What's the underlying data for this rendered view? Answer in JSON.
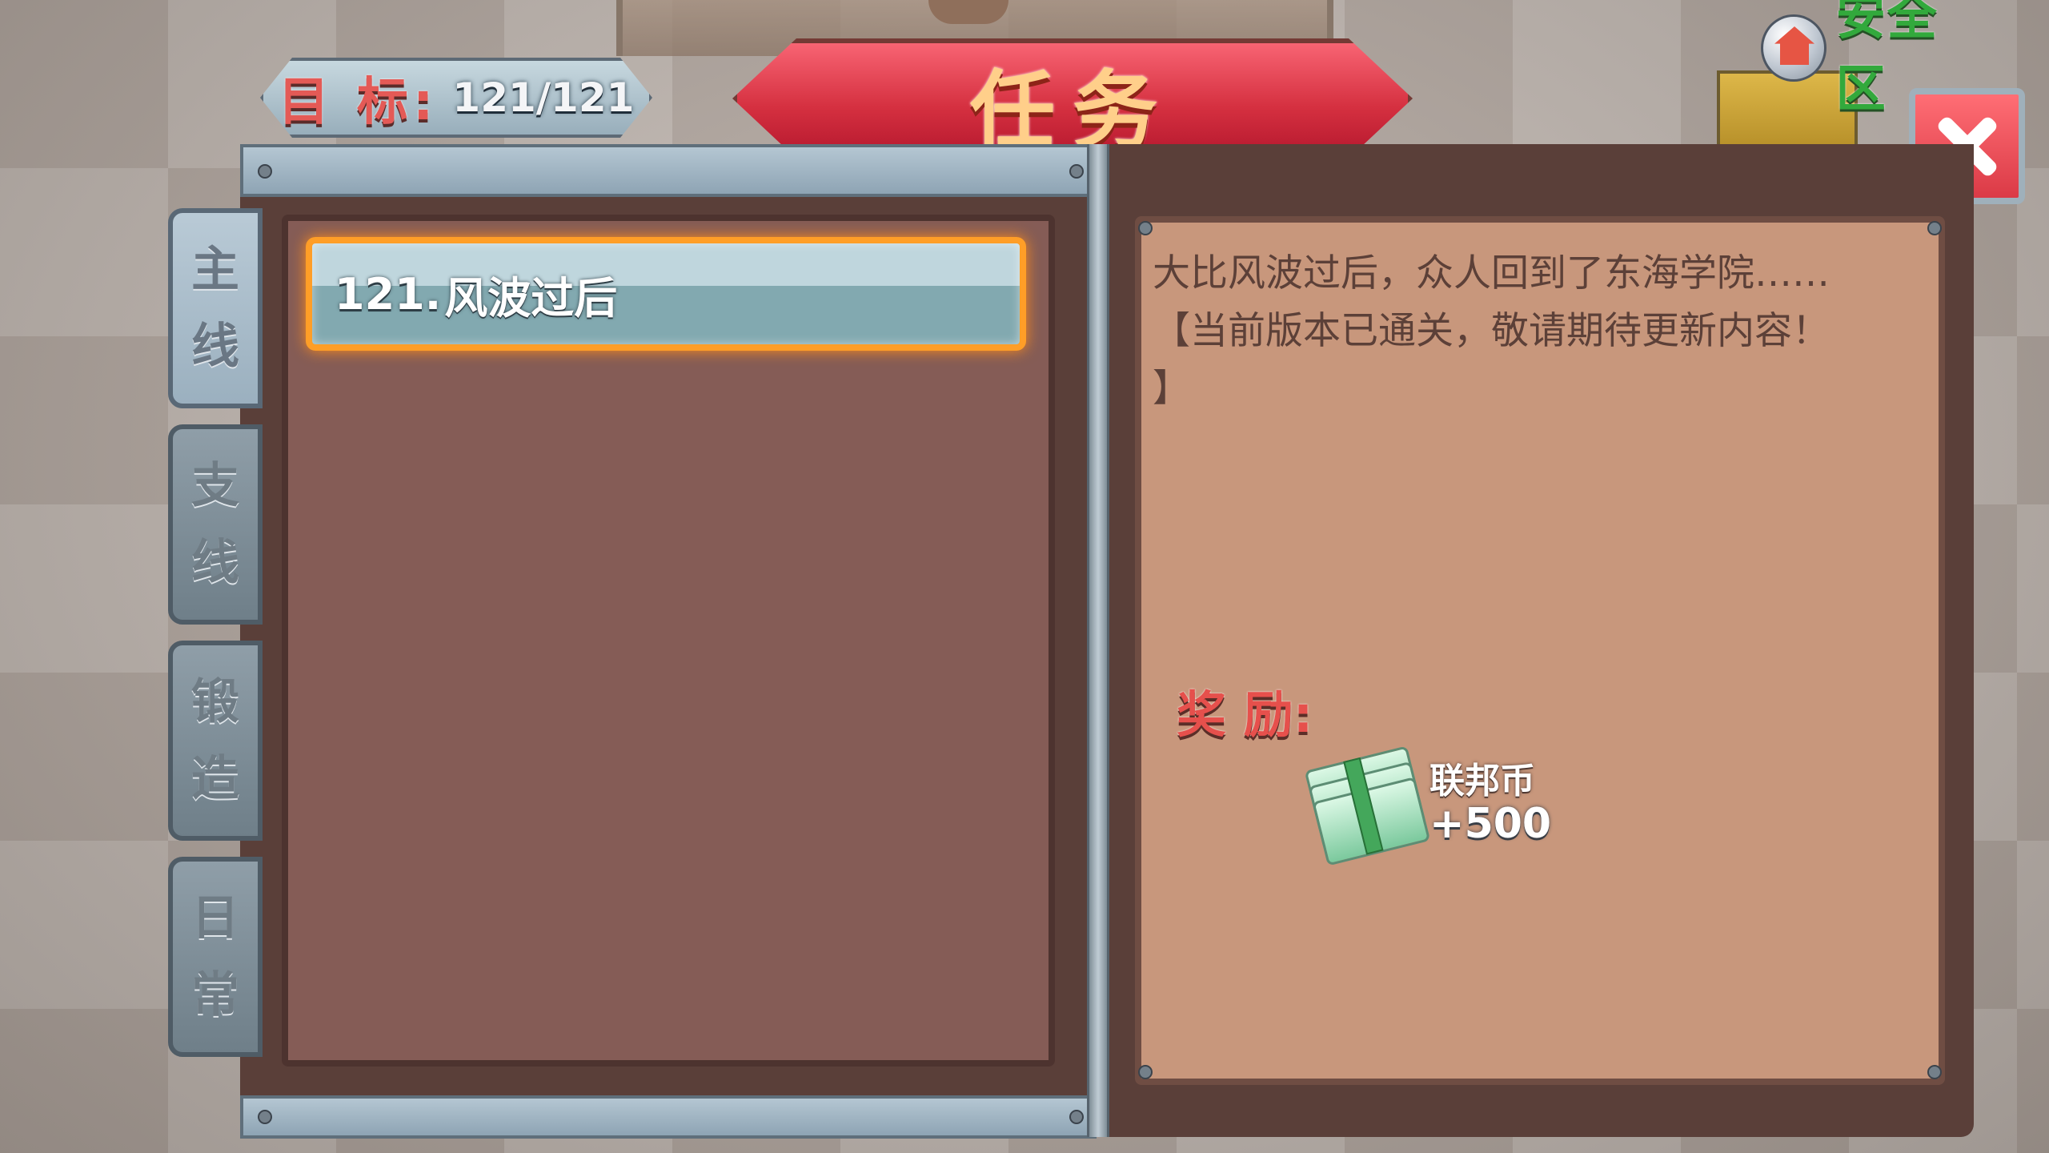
{
  "header": {
    "objective_label": "目 标:",
    "objective_value": "121/121",
    "title": "任务",
    "safe_zone": "安全区"
  },
  "tabs": [
    {
      "line1": "主",
      "line2": "线"
    },
    {
      "line1": "支",
      "line2": "线"
    },
    {
      "line1": "锻",
      "line2": "造"
    },
    {
      "line1": "日",
      "line2": "常"
    }
  ],
  "quest_list": {
    "selected": {
      "number": "121.",
      "title": "风波过后"
    }
  },
  "quest_detail": {
    "description": "大比风波过后，众人回到了东海学院……\n【当前版本已通关，敬请期待更新内容！\n】",
    "reward_label": "奖 励:",
    "reward": {
      "name": "联邦币",
      "amount": "+500",
      "icon": "cash-stack-icon"
    }
  }
}
